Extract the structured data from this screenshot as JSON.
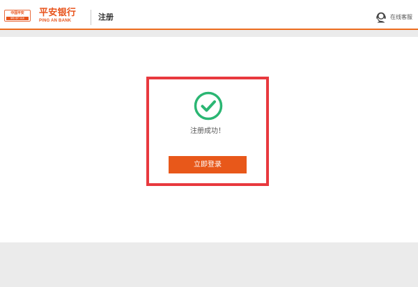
{
  "header": {
    "logo_badge_text": "中国平安",
    "logo_badge_subtext": "保险·银行·投资",
    "brand_name_cn": "平安银行",
    "brand_name_en": "PING AN BANK",
    "title": "注册",
    "support_label": "在线客服",
    "support_icon": "headset-icon"
  },
  "main": {
    "success_icon": "check-circle-icon",
    "success_message": "注册成功！",
    "login_button_label": "立即登录"
  },
  "colors": {
    "brand_orange": "#e8581a",
    "header_border": "#ec6b1e",
    "success_green": "#2bb673",
    "highlight_red": "#e8393e",
    "page_background": "#ebebeb"
  }
}
